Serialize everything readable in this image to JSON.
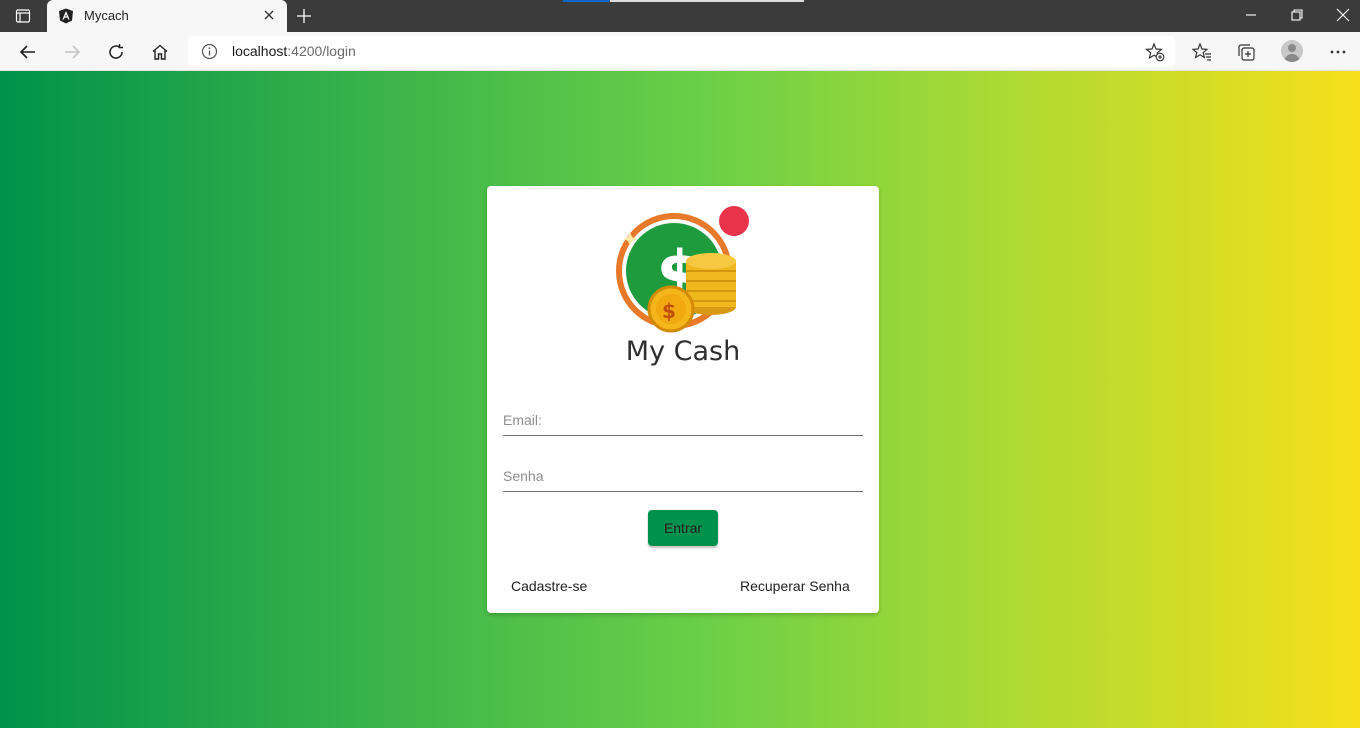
{
  "browser": {
    "tab_title": "Mycach",
    "address": {
      "host": "localhost",
      "path": ":4200/login"
    }
  },
  "login": {
    "logo_text": "My Cash",
    "email_placeholder": "Email:",
    "password_placeholder": "Senha",
    "submit_label": "Entrar",
    "register_link": "Cadastre-se",
    "recover_link": "Recuperar Senha"
  },
  "theme": {
    "gradient_start": "#00924a",
    "gradient_mid": "#6bd047",
    "gradient_end": "#f7df1b",
    "button_color": "#00914d"
  }
}
